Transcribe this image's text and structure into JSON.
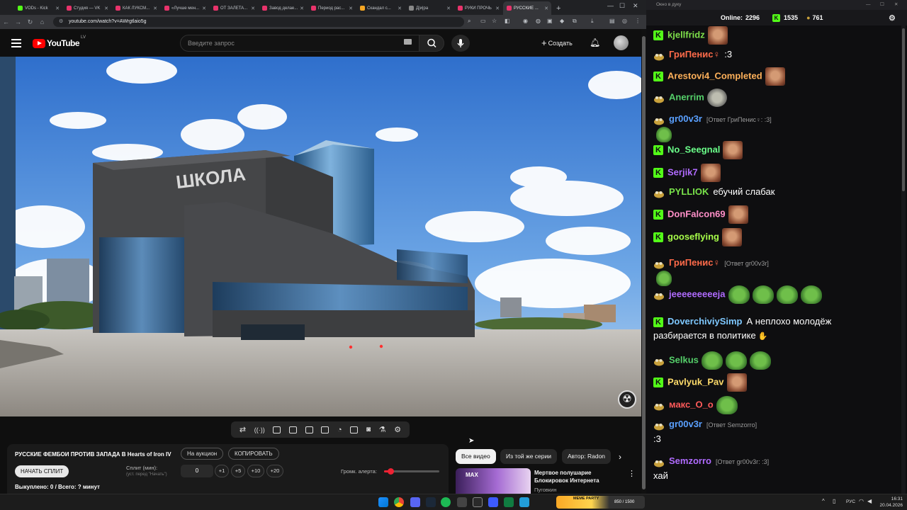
{
  "browser": {
    "tabs": [
      {
        "label": "VODs - Kick",
        "color": "#53fc18"
      },
      {
        "label": "Студия — VK",
        "color": "#e8336b"
      },
      {
        "label": "КАК ЛУКСМ...",
        "color": "#e8336b"
      },
      {
        "label": "«Лучше мен...",
        "color": "#e8336b"
      },
      {
        "label": "ОТ ЗАЛЕТА...",
        "color": "#e8336b"
      },
      {
        "label": "Завод делае...",
        "color": "#e8336b"
      },
      {
        "label": "Период рас...",
        "color": "#e8336b"
      },
      {
        "label": "Скандал с...",
        "color": "#f5a623"
      },
      {
        "label": "Д|и|ра",
        "color": "#888888"
      },
      {
        "label": "РУКИ ПРОЧЬ",
        "color": "#e8336b"
      },
      {
        "label": "РУССКИЕ ...",
        "color": "#e8336b",
        "active": true
      }
    ],
    "url": "youtube.com/watch?v=AWrgtlaio5g"
  },
  "youtube": {
    "logo_text": "YouTube",
    "country": "LV",
    "search_placeholder": "Введите запрос",
    "create_label": "Создать",
    "video": {
      "sign_text": "ШКОЛА"
    }
  },
  "auction": {
    "title": "РУССКИЕ ФЕМБОИ ПРОТИВ ЗАПАДА В Hearts of Iron IV",
    "to_auction": "На аукцион",
    "copy": "КОПИРОВАТЬ",
    "start_split": "НАЧАТЬ СПЛИТ",
    "split_label": "Сплит (мин):",
    "split_hint": "(уст. перед \"Начать\")",
    "split_value": "0",
    "increments": [
      "+1",
      "+5",
      "+10",
      "+20"
    ],
    "alert_volume_label": "Громк. алерта:",
    "alert_volume_level": 0.12,
    "sold": "Выкуплено: 0 / Всего: ? минут"
  },
  "recommendations": {
    "chips": [
      {
        "label": "Все видео",
        "active": true
      },
      {
        "label": "Из той же серии",
        "active": false
      },
      {
        "label": "Автор: Radon",
        "active": false
      }
    ],
    "item": {
      "thumb_tag": "MAX",
      "title": "Мертвое полушарие Блокировок Интернета",
      "channel": "Пуговкин"
    }
  },
  "chat": {
    "window_title": "Окно в дуку",
    "online_label": "Online:",
    "online_count": "2296",
    "kick_count": "1535",
    "pepe_count": "761",
    "messages": [
      {
        "badge": "kick",
        "user": "kjellfridz",
        "color": "#7ee04a",
        "emotes": [
          "face"
        ]
      },
      {
        "badge": "pepe",
        "user": "ГриПенис♀",
        "color": "#ff6b4a",
        "text": ":3"
      },
      {
        "badge": "kick",
        "user": "Arestovi4_Completed",
        "color": "#ffb15a",
        "emotes": [
          "face"
        ]
      },
      {
        "badge": "pepe",
        "user": "Anerrim",
        "color": "#55d06a",
        "emotes": [
          "grey"
        ]
      },
      {
        "badge": "pepe",
        "user": "gr00v3r",
        "color": "#5aa0ff",
        "reply": "[Ответ ГриПенис♀: :3]",
        "line2_emote": "frog"
      },
      {
        "badge": "kick",
        "user": "No_Seegnal",
        "color": "#6bff8a",
        "emotes": [
          "face"
        ]
      },
      {
        "badge": "kick",
        "user": "Serjik7",
        "color": "#b06bff",
        "emotes": [
          "face"
        ]
      },
      {
        "badge": "pepe",
        "user": "PYLLIOK",
        "color": "#79e34a",
        "text": "ебучий слабак"
      },
      {
        "badge": "kick",
        "user": "DonFalcon69",
        "color": "#ff8fc8",
        "emotes": [
          "face"
        ]
      },
      {
        "badge": "kick",
        "user": "gooseflying",
        "color": "#a8ff4a",
        "emotes": [
          "face"
        ]
      },
      {
        "badge": "pepe",
        "user": "ГриПенис♀",
        "color": "#ff6b4a",
        "reply": "[Ответ gr00v3r]",
        "line2_emote": "frog"
      },
      {
        "badge": "pepe",
        "user": "jeeeeeeeeeja",
        "color": "#b06bff",
        "emotes": [
          "frog",
          "frog",
          "frog",
          "frog"
        ]
      },
      {
        "badge": "kick",
        "user": "DoverchiviySimp",
        "color": "#7ec8ff",
        "text": "А неплохо молодёж",
        "line2": "разбирается в политике"
      },
      {
        "badge": "pepe",
        "user": "Selkus",
        "color": "#55d06a",
        "emotes": [
          "frog",
          "frog",
          "frog"
        ]
      },
      {
        "badge": "kick",
        "user": "Pavlyuk_Pav",
        "color": "#ffdc6b",
        "emotes": [
          "face"
        ]
      },
      {
        "badge": "pepe",
        "user": "макс_O_o",
        "color": "#ff5a5a",
        "emotes": [
          "frog"
        ]
      },
      {
        "badge": "pepe",
        "user": "gr00v3r",
        "color": "#5aa0ff",
        "reply": "[Ответ Semzorro]",
        "line2": ":3"
      },
      {
        "badge": "pepe",
        "user": "Semzorro",
        "color": "#b06bff",
        "reply": "[Ответ gr00v3r: :3]",
        "line2": "хай"
      }
    ]
  },
  "taskbar": {
    "meme_title": "MEME PARTY",
    "meme_progress": "850 / 1500",
    "lang": "РУС",
    "time": "16:31",
    "date": "20.04.2026"
  }
}
